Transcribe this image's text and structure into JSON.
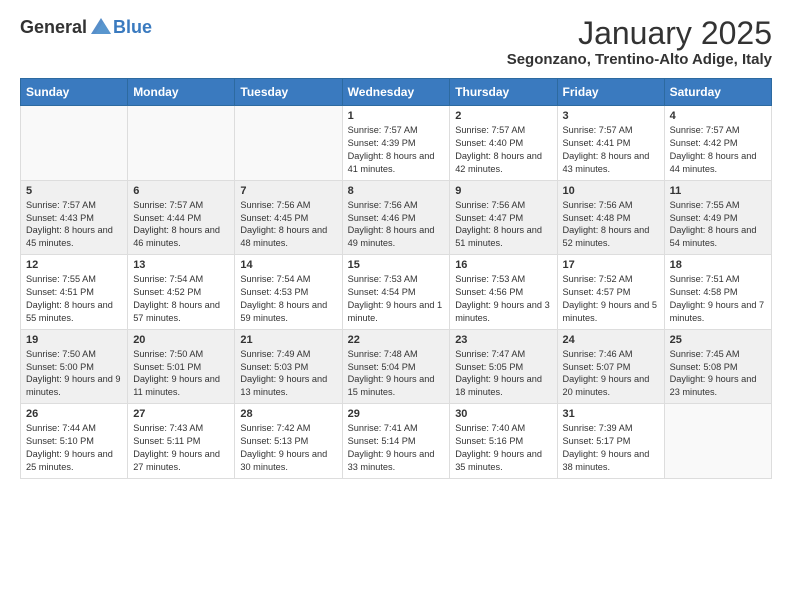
{
  "header": {
    "logo_general": "General",
    "logo_blue": "Blue",
    "month_title": "January 2025",
    "location": "Segonzano, Trentino-Alto Adige, Italy"
  },
  "weekdays": [
    "Sunday",
    "Monday",
    "Tuesday",
    "Wednesday",
    "Thursday",
    "Friday",
    "Saturday"
  ],
  "weeks": [
    [
      {
        "day": "",
        "sunrise": "",
        "sunset": "",
        "daylight": ""
      },
      {
        "day": "",
        "sunrise": "",
        "sunset": "",
        "daylight": ""
      },
      {
        "day": "",
        "sunrise": "",
        "sunset": "",
        "daylight": ""
      },
      {
        "day": "1",
        "sunrise": "Sunrise: 7:57 AM",
        "sunset": "Sunset: 4:39 PM",
        "daylight": "Daylight: 8 hours and 41 minutes."
      },
      {
        "day": "2",
        "sunrise": "Sunrise: 7:57 AM",
        "sunset": "Sunset: 4:40 PM",
        "daylight": "Daylight: 8 hours and 42 minutes."
      },
      {
        "day": "3",
        "sunrise": "Sunrise: 7:57 AM",
        "sunset": "Sunset: 4:41 PM",
        "daylight": "Daylight: 8 hours and 43 minutes."
      },
      {
        "day": "4",
        "sunrise": "Sunrise: 7:57 AM",
        "sunset": "Sunset: 4:42 PM",
        "daylight": "Daylight: 8 hours and 44 minutes."
      }
    ],
    [
      {
        "day": "5",
        "sunrise": "Sunrise: 7:57 AM",
        "sunset": "Sunset: 4:43 PM",
        "daylight": "Daylight: 8 hours and 45 minutes."
      },
      {
        "day": "6",
        "sunrise": "Sunrise: 7:57 AM",
        "sunset": "Sunset: 4:44 PM",
        "daylight": "Daylight: 8 hours and 46 minutes."
      },
      {
        "day": "7",
        "sunrise": "Sunrise: 7:56 AM",
        "sunset": "Sunset: 4:45 PM",
        "daylight": "Daylight: 8 hours and 48 minutes."
      },
      {
        "day": "8",
        "sunrise": "Sunrise: 7:56 AM",
        "sunset": "Sunset: 4:46 PM",
        "daylight": "Daylight: 8 hours and 49 minutes."
      },
      {
        "day": "9",
        "sunrise": "Sunrise: 7:56 AM",
        "sunset": "Sunset: 4:47 PM",
        "daylight": "Daylight: 8 hours and 51 minutes."
      },
      {
        "day": "10",
        "sunrise": "Sunrise: 7:56 AM",
        "sunset": "Sunset: 4:48 PM",
        "daylight": "Daylight: 8 hours and 52 minutes."
      },
      {
        "day": "11",
        "sunrise": "Sunrise: 7:55 AM",
        "sunset": "Sunset: 4:49 PM",
        "daylight": "Daylight: 8 hours and 54 minutes."
      }
    ],
    [
      {
        "day": "12",
        "sunrise": "Sunrise: 7:55 AM",
        "sunset": "Sunset: 4:51 PM",
        "daylight": "Daylight: 8 hours and 55 minutes."
      },
      {
        "day": "13",
        "sunrise": "Sunrise: 7:54 AM",
        "sunset": "Sunset: 4:52 PM",
        "daylight": "Daylight: 8 hours and 57 minutes."
      },
      {
        "day": "14",
        "sunrise": "Sunrise: 7:54 AM",
        "sunset": "Sunset: 4:53 PM",
        "daylight": "Daylight: 8 hours and 59 minutes."
      },
      {
        "day": "15",
        "sunrise": "Sunrise: 7:53 AM",
        "sunset": "Sunset: 4:54 PM",
        "daylight": "Daylight: 9 hours and 1 minute."
      },
      {
        "day": "16",
        "sunrise": "Sunrise: 7:53 AM",
        "sunset": "Sunset: 4:56 PM",
        "daylight": "Daylight: 9 hours and 3 minutes."
      },
      {
        "day": "17",
        "sunrise": "Sunrise: 7:52 AM",
        "sunset": "Sunset: 4:57 PM",
        "daylight": "Daylight: 9 hours and 5 minutes."
      },
      {
        "day": "18",
        "sunrise": "Sunrise: 7:51 AM",
        "sunset": "Sunset: 4:58 PM",
        "daylight": "Daylight: 9 hours and 7 minutes."
      }
    ],
    [
      {
        "day": "19",
        "sunrise": "Sunrise: 7:50 AM",
        "sunset": "Sunset: 5:00 PM",
        "daylight": "Daylight: 9 hours and 9 minutes."
      },
      {
        "day": "20",
        "sunrise": "Sunrise: 7:50 AM",
        "sunset": "Sunset: 5:01 PM",
        "daylight": "Daylight: 9 hours and 11 minutes."
      },
      {
        "day": "21",
        "sunrise": "Sunrise: 7:49 AM",
        "sunset": "Sunset: 5:03 PM",
        "daylight": "Daylight: 9 hours and 13 minutes."
      },
      {
        "day": "22",
        "sunrise": "Sunrise: 7:48 AM",
        "sunset": "Sunset: 5:04 PM",
        "daylight": "Daylight: 9 hours and 15 minutes."
      },
      {
        "day": "23",
        "sunrise": "Sunrise: 7:47 AM",
        "sunset": "Sunset: 5:05 PM",
        "daylight": "Daylight: 9 hours and 18 minutes."
      },
      {
        "day": "24",
        "sunrise": "Sunrise: 7:46 AM",
        "sunset": "Sunset: 5:07 PM",
        "daylight": "Daylight: 9 hours and 20 minutes."
      },
      {
        "day": "25",
        "sunrise": "Sunrise: 7:45 AM",
        "sunset": "Sunset: 5:08 PM",
        "daylight": "Daylight: 9 hours and 23 minutes."
      }
    ],
    [
      {
        "day": "26",
        "sunrise": "Sunrise: 7:44 AM",
        "sunset": "Sunset: 5:10 PM",
        "daylight": "Daylight: 9 hours and 25 minutes."
      },
      {
        "day": "27",
        "sunrise": "Sunrise: 7:43 AM",
        "sunset": "Sunset: 5:11 PM",
        "daylight": "Daylight: 9 hours and 27 minutes."
      },
      {
        "day": "28",
        "sunrise": "Sunrise: 7:42 AM",
        "sunset": "Sunset: 5:13 PM",
        "daylight": "Daylight: 9 hours and 30 minutes."
      },
      {
        "day": "29",
        "sunrise": "Sunrise: 7:41 AM",
        "sunset": "Sunset: 5:14 PM",
        "daylight": "Daylight: 9 hours and 33 minutes."
      },
      {
        "day": "30",
        "sunrise": "Sunrise: 7:40 AM",
        "sunset": "Sunset: 5:16 PM",
        "daylight": "Daylight: 9 hours and 35 minutes."
      },
      {
        "day": "31",
        "sunrise": "Sunrise: 7:39 AM",
        "sunset": "Sunset: 5:17 PM",
        "daylight": "Daylight: 9 hours and 38 minutes."
      },
      {
        "day": "",
        "sunrise": "",
        "sunset": "",
        "daylight": ""
      }
    ]
  ]
}
